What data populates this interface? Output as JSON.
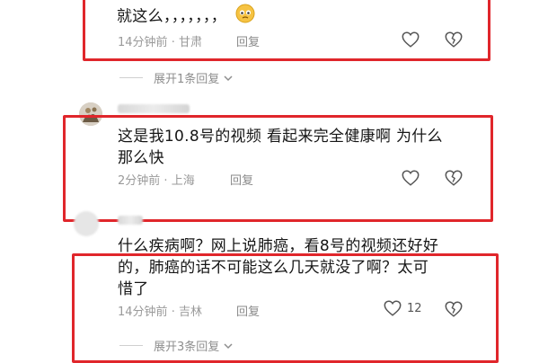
{
  "comments": [
    {
      "text_line1": "就这么，，，，，，，",
      "time": "14分钟前",
      "location": "甘肃",
      "reply_label": "回复",
      "like_count": "",
      "expand_label": "展开1条回复"
    },
    {
      "text_line1": "这是我10.8号的视频 看起来完全健康啊 为什么",
      "text_line2": "那么快",
      "time": "2分钟前",
      "location": "上海",
      "reply_label": "回复",
      "like_count": ""
    },
    {
      "text_line1": "什么疾病啊？网上说肺癌，看8号的视频还好好",
      "text_line2": "的，肺癌的话不可能这么几天就没了啊？太可",
      "text_line3": "惜了",
      "time": "14分钟前",
      "location": "吉林",
      "reply_label": "回复",
      "like_count": "12",
      "expand_label": "展开3条回复"
    }
  ],
  "separator": "·",
  "colors": {
    "highlight_box": "#e0262b",
    "meta_text": "#9a9a9a"
  },
  "icons": [
    "heart-icon",
    "broken-heart-icon",
    "chevron-down-icon",
    "emoji-icon"
  ]
}
